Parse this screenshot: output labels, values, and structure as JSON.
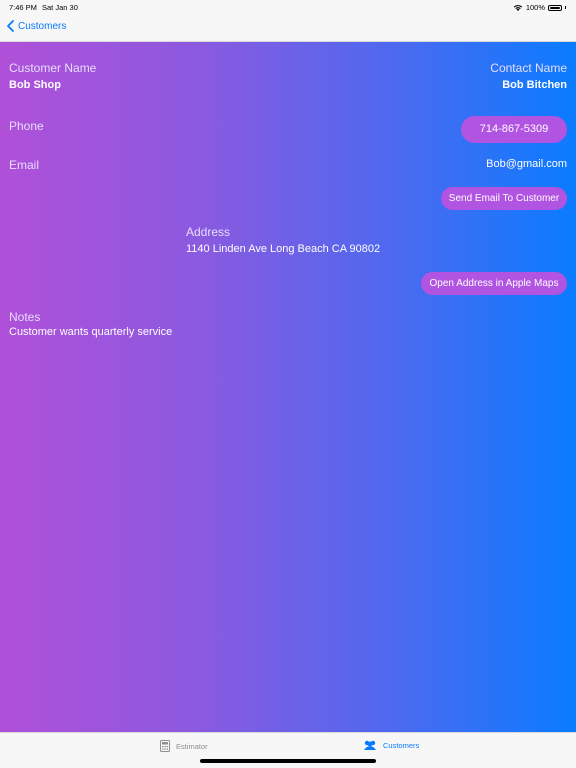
{
  "status_bar": {
    "time": "7:46 PM",
    "date": "Sat Jan 30",
    "battery": "100%"
  },
  "nav": {
    "back_label": "Customers"
  },
  "customer": {
    "name_label": "Customer Name",
    "name": "Bob Shop",
    "contact_label": "Contact Name",
    "contact": "Bob Bitchen",
    "phone_label": "Phone",
    "phone": "714-867-5309",
    "email_label": "Email",
    "email": "Bob@gmail.com",
    "send_email_button": "Send Email To Customer",
    "address_label": "Address",
    "address": "1140 Linden Ave Long Beach CA 90802",
    "open_maps_button": "Open Address in Apple Maps",
    "notes_label": "Notes",
    "notes": "Customer wants quarterly service"
  },
  "tabs": [
    {
      "label": "Estimator",
      "icon": "calculator-icon"
    },
    {
      "label": "Customers",
      "icon": "people-icon"
    }
  ],
  "colors": {
    "accent": "#0a7aff",
    "gradient_start": "#b050d8",
    "gradient_end": "#0a7cff",
    "pill": "#b154e2"
  }
}
